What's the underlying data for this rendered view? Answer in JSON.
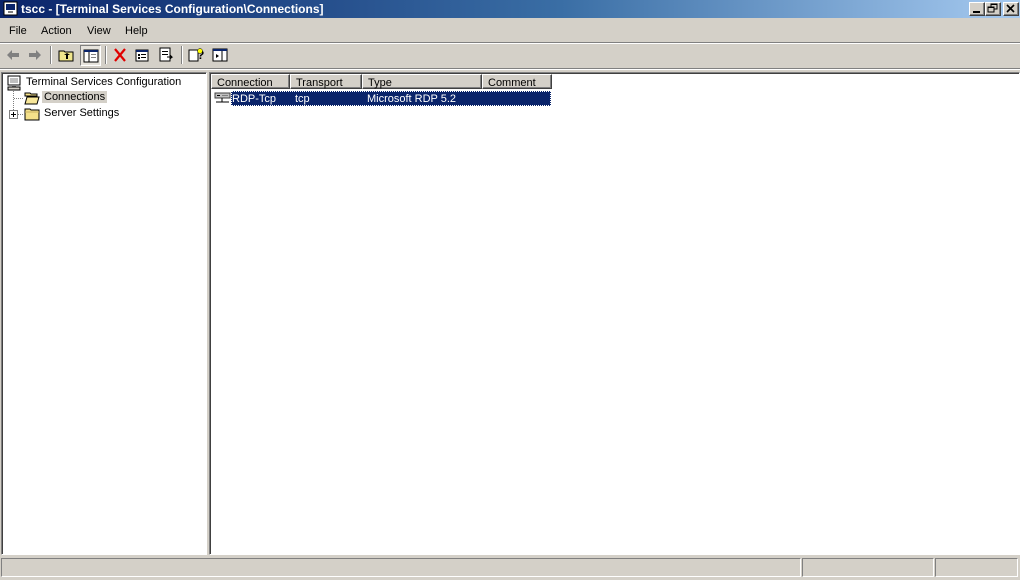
{
  "window": {
    "title": "tscc - [Terminal Services Configuration\\Connections]"
  },
  "menu": {
    "items": [
      {
        "label": "File"
      },
      {
        "label": "Action"
      },
      {
        "label": "View"
      },
      {
        "label": "Help"
      }
    ]
  },
  "toolbar": {
    "buttons": [
      {
        "icon": "back-arrow-icon"
      },
      {
        "icon": "forward-arrow-icon"
      },
      {
        "icon": "up-folder-icon"
      },
      {
        "icon": "show-hide-tree-icon"
      },
      {
        "icon": "delete-icon"
      },
      {
        "icon": "properties-icon"
      },
      {
        "icon": "export-list-icon"
      },
      {
        "icon": "help-icon"
      },
      {
        "icon": "show-hide-action-pane-icon"
      }
    ]
  },
  "tree": {
    "root": {
      "label": "Terminal Services Configuration",
      "icon": "computer-console-icon"
    },
    "children": [
      {
        "label": "Connections",
        "icon": "open-folder-icon",
        "selected": true
      },
      {
        "label": "Server Settings",
        "icon": "folder-icon",
        "expandable": true
      }
    ]
  },
  "list": {
    "columns": [
      "Connection",
      "Transport",
      "Type",
      "Comment"
    ],
    "rows": [
      {
        "connection": "RDP-Tcp",
        "transport": "tcp",
        "type": "Microsoft RDP 5.2",
        "comment": "",
        "icon": "network-connection-icon",
        "selected": true
      }
    ]
  },
  "colors": {
    "title_start": "#0a246a",
    "title_end": "#a6caf0",
    "selection": "#0a246a",
    "face": "#d4d0c8"
  }
}
